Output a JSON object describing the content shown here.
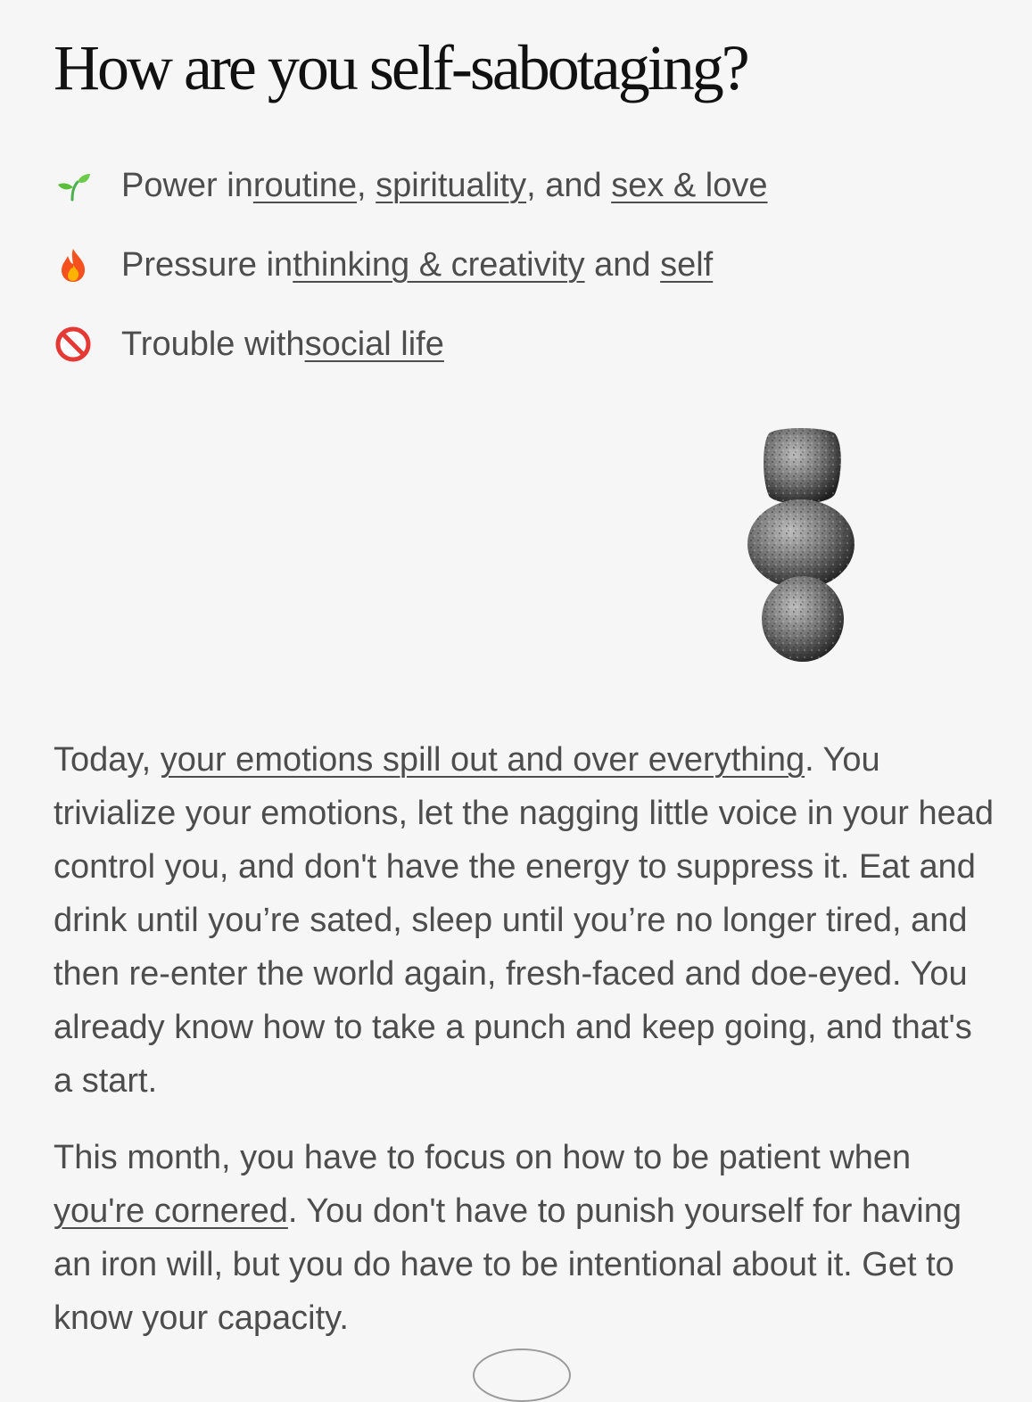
{
  "title": "How are you self-sabotaging?",
  "summary": [
    {
      "icon": "seedling-icon",
      "prefix": "Power in ",
      "link1": "routine",
      "sep1": ", ",
      "link2": "spirituality",
      "sep2": ", and ",
      "link3": "sex & love"
    },
    {
      "icon": "fire-icon",
      "prefix": "Pressure in ",
      "link1": "thinking & creativity",
      "sep1": " and ",
      "link2": "self"
    },
    {
      "icon": "no-entry-icon",
      "prefix": "Trouble with ",
      "link1": "social life"
    }
  ],
  "illustration": "stacked-stones-illustration",
  "paragraph1": {
    "lead": "Today, ",
    "link": "your emotions spill out and over everything",
    "rest": ". You trivialize your emotions, let the nagging little voice in your head control you, and don't have the energy to suppress it. Eat and drink until you’re sated, sleep until you’re no longer tired, and then re-enter the world again, fresh-faced and doe-eyed. You already know how to take a punch and keep going, and that's a start."
  },
  "paragraph2": {
    "lead": "This month, you have to focus on how to be patient when ",
    "link": "you're cornered",
    "rest": ". You don't have to punish yourself for having an iron will, but you do have to be intentional about it. Get to know your capacity."
  },
  "colors": {
    "background": "#f6f6f6",
    "title": "#111111",
    "text": "#4d4d4d"
  }
}
